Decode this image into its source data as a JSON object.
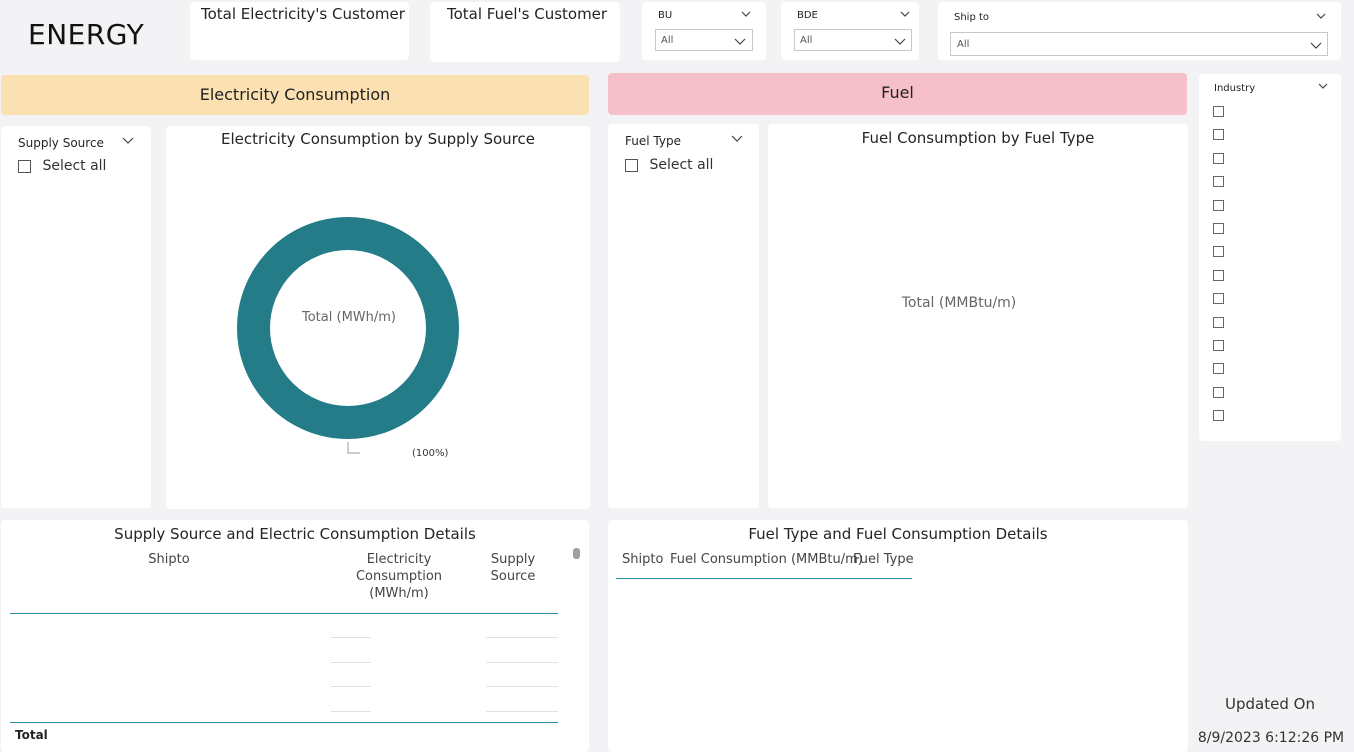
{
  "page_title": "ENERGY",
  "cards": {
    "electricity_customers": "Total Electricity's Customer",
    "fuel_customers": "Total Fuel's Customer"
  },
  "filters": {
    "bu": {
      "label": "BU",
      "value": "All"
    },
    "bde": {
      "label": "BDE",
      "value": "All"
    },
    "ship_to": {
      "label": "Ship to",
      "value": "All"
    },
    "industry": {
      "label": "Industry",
      "item_count": 14
    }
  },
  "electricity": {
    "banner": "Electricity Consumption",
    "banner_color": "#fbe0b1",
    "slicer_label": "Supply Source",
    "select_all": "Select all",
    "chart_title": "Electricity Consumption by Supply Source",
    "donut_center": "Total (MWh/m)",
    "donut_label": "(100%)",
    "donut_color": "#257c89",
    "table_title": "Supply Source and Electric Consumption Details",
    "table_headers": [
      "Shipto",
      "Electricity Consumption (MWh/m)",
      "Supply Source"
    ],
    "total_label": "Total"
  },
  "fuel": {
    "banner": "Fuel",
    "banner_color": "#f6c0ca",
    "slicer_label": "Fuel Type",
    "select_all": "Select all",
    "chart_title": "Fuel Consumption by Fuel Type",
    "chart_center": "Total (MMBtu/m)",
    "table_title": "Fuel Type and Fuel Consumption Details",
    "table_headers": [
      "Shipto",
      "Fuel Consumption (MMBtu/m)",
      "Fuel Type"
    ]
  },
  "updated": {
    "label": "Updated On",
    "value": "8/9/2023 6:12:26 PM"
  },
  "chart_data": {
    "type": "pie",
    "title": "Electricity Consumption by Supply Source",
    "categories": [
      ""
    ],
    "values": [
      100
    ],
    "center_label": "Total (MWh/m)",
    "data_labels": [
      "(100%)"
    ]
  }
}
